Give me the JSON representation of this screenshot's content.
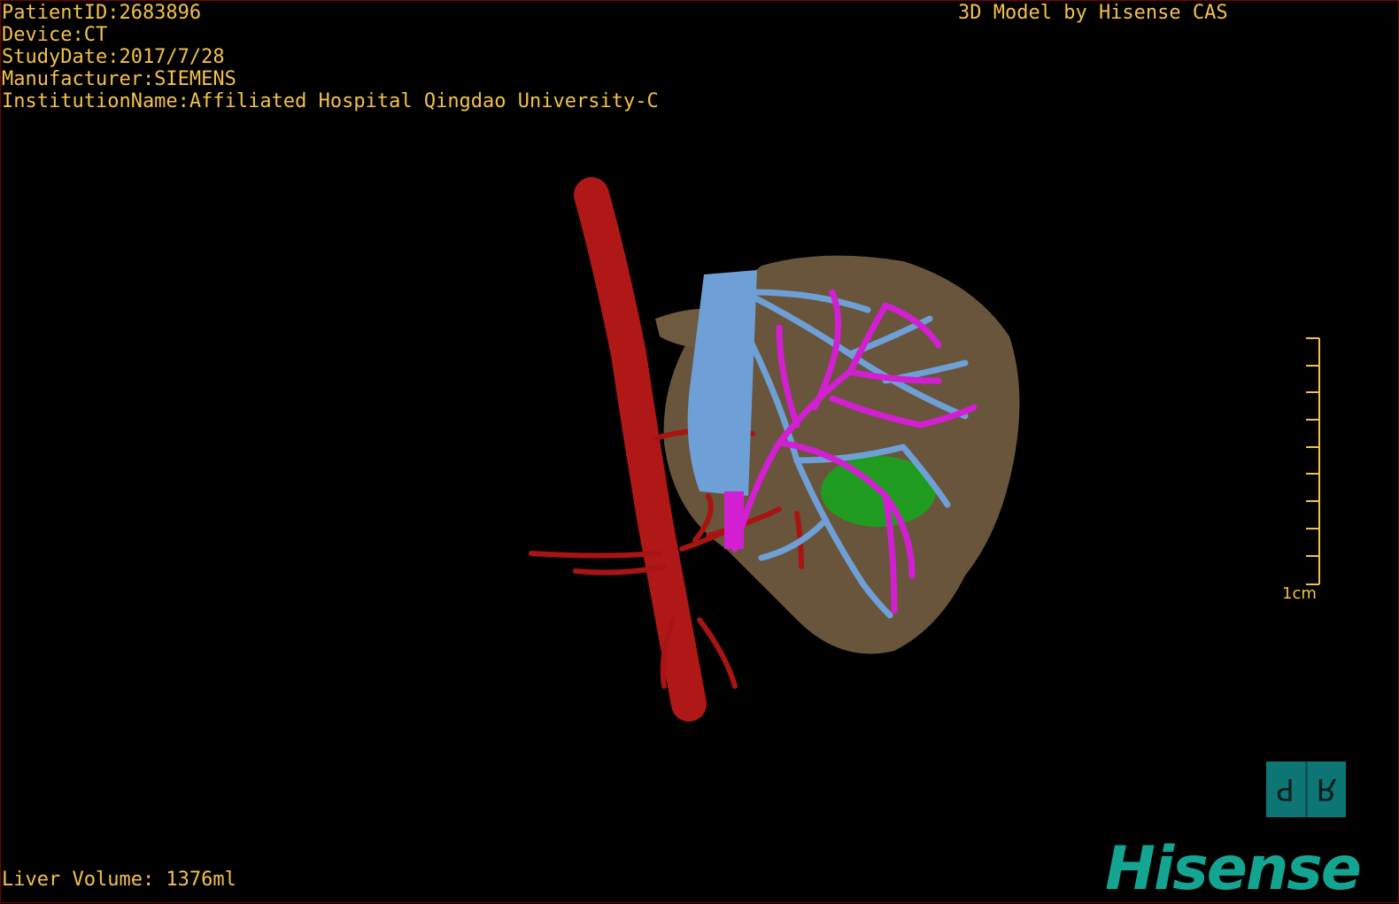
{
  "patient_info": {
    "patient_id": "PatientID:2683896",
    "device": "Device:CT",
    "study_date": "StudyDate:2017/7/28",
    "manufacturer": "Manufacturer:SIEMENS",
    "institution": "InstitutionName:Affiliated Hospital Qingdao University-C"
  },
  "credit": "3D Model by Hisense CAS",
  "liver_volume": "Liver Volume: 1376ml",
  "scale": {
    "label": "1cm"
  },
  "orientation": {
    "left_glyph": "P",
    "right_glyph": "R"
  },
  "brand": {
    "logo_text": "Hisense",
    "logo_color": "#14a592"
  },
  "colors": {
    "text": "#f2c14e",
    "artery": "#b01818",
    "portal_vein": "#d21fd2",
    "hepatic_vein": "#6e9fd6",
    "liver": "#6e5a3e",
    "gallbladder": "#1f9c1f"
  }
}
